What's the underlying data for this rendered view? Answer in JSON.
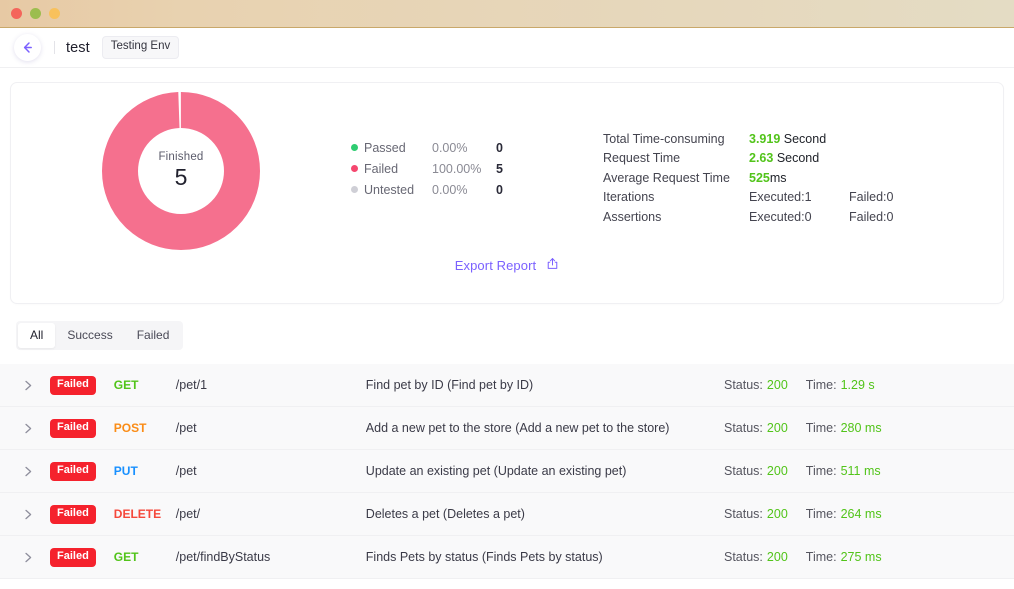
{
  "window": {
    "traffic_lights": [
      "close",
      "minimize",
      "maximize"
    ]
  },
  "topbar": {
    "back_icon": "arrow-left-icon",
    "project_name": "test",
    "env_badge": "Testing Env"
  },
  "summary": {
    "donut": {
      "status_label": "Finished",
      "count": "5",
      "ring_color": "#f5708e",
      "failed_fraction": 1.0
    },
    "legend": [
      {
        "name": "Passed",
        "percent": "0.00%",
        "value": "0",
        "color": "#2ecc71"
      },
      {
        "name": "Failed",
        "percent": "100.00%",
        "value": "5",
        "color": "#f5476f"
      },
      {
        "name": "Untested",
        "percent": "0.00%",
        "value": "0",
        "color": "#cfcfd6"
      }
    ],
    "stats": [
      {
        "label": "Total Time-consuming",
        "value": "3.919",
        "unit": " Second",
        "highlight": true
      },
      {
        "label": "Request Time",
        "value": "2.63",
        "unit": " Second",
        "highlight": true
      },
      {
        "label": "Average Request Time",
        "value": "525",
        "unit": "ms",
        "highlight": true
      }
    ],
    "counters": [
      {
        "label": "Iterations",
        "executed": "Executed:1",
        "failed": "Failed:0"
      },
      {
        "label": "Assertions",
        "executed": "Executed:0",
        "failed": "Failed:0"
      }
    ],
    "export_label": "Export Report",
    "export_icon": "share-upload-icon",
    "link_color": "#7b61ff"
  },
  "filter_tabs": [
    {
      "label": "All",
      "active": true
    },
    {
      "label": "Success",
      "active": false
    },
    {
      "label": "Failed",
      "active": false
    }
  ],
  "results": {
    "status_prefix": "Status:",
    "time_prefix": "Time:",
    "rows": [
      {
        "expand_icon": "chevron-right-icon",
        "badge": "Failed",
        "method": "GET",
        "path": "/pet/1",
        "description": "Find pet by ID (Find pet by ID)",
        "status": "200",
        "time": "1.29 s"
      },
      {
        "expand_icon": "chevron-right-icon",
        "badge": "Failed",
        "method": "POST",
        "path": "/pet",
        "description": "Add a new pet to the store (Add a new pet to the store)",
        "status": "200",
        "time": "280 ms"
      },
      {
        "expand_icon": "chevron-right-icon",
        "badge": "Failed",
        "method": "PUT",
        "path": "/pet",
        "description": "Update an existing pet (Update an existing pet)",
        "status": "200",
        "time": "511 ms"
      },
      {
        "expand_icon": "chevron-right-icon",
        "badge": "Failed",
        "method": "DELETE",
        "path": "/pet/",
        "description": "Deletes a pet (Deletes a pet)",
        "status": "200",
        "time": "264 ms"
      },
      {
        "expand_icon": "chevron-right-icon",
        "badge": "Failed",
        "method": "GET",
        "path": "/pet/findByStatus",
        "description": "Finds Pets by status (Finds Pets by status)",
        "status": "200",
        "time": "275 ms"
      }
    ]
  }
}
